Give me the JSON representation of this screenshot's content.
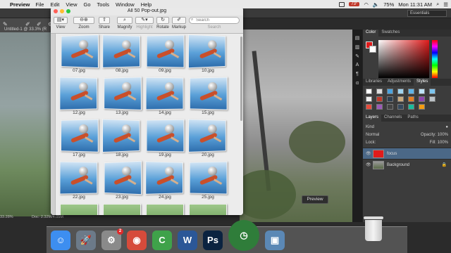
{
  "menubar": {
    "apple": "",
    "app": "Preview",
    "items": [
      "File",
      "Edit",
      "View",
      "Go",
      "Tools",
      "Window",
      "Help"
    ],
    "temp": "73°",
    "battery": "75%",
    "clock": "Mon 11:31 AM"
  },
  "photoshop": {
    "workspace": "Essentials",
    "doc_tab": "Untitled-1 @ 33.3% (R",
    "status_zoom": "33.28%",
    "status_doc": "Doc: 2.32M/4.05M",
    "preview_label": "Preview",
    "panel_tabs_top": [
      "Color",
      "Swatches"
    ],
    "panel_tabs_mid": [
      "Libraries",
      "Adjustments",
      "Styles"
    ],
    "panel_tabs_layers": [
      "Layers",
      "Channels",
      "Paths"
    ],
    "layers_filter": "Kind",
    "blend_mode": "Normal",
    "opacity_label": "Opacity:",
    "opacity_value": "100%",
    "lock_label": "Lock:",
    "fill_label": "Fill:",
    "fill_value": "100%",
    "layers": [
      {
        "name": "focus",
        "selected": true
      },
      {
        "name": "Background",
        "selected": false
      }
    ],
    "colors": {
      "foreground": "#e01b1b",
      "background": "#ffffff"
    }
  },
  "quicklook": {
    "title": "All 50 Pop-out.jpg",
    "toolbar": {
      "view": "View",
      "zoom": "Zoom",
      "share": "Share",
      "magnify": "Magnify",
      "highlight": "Highlight",
      "rotate": "Rotate",
      "markup": "Markup",
      "search_label": "Search",
      "search_placeholder": "Search"
    },
    "thumbnails": [
      "07.jpg",
      "08.jpg",
      "09.jpg",
      "10.jpg",
      "12.jpg",
      "13.jpg",
      "14.jpg",
      "15.jpg",
      "17.jpg",
      "18.jpg",
      "19.jpg",
      "20.jpg",
      "22.jpg",
      "23.jpg",
      "24.jpg",
      "25.jpg"
    ]
  },
  "dock": {
    "items": [
      {
        "name": "finder-icon",
        "glyph": "☺",
        "bg": "#3d8ef0"
      },
      {
        "name": "launchpad-icon",
        "glyph": "🚀",
        "bg": "#6c7a89"
      },
      {
        "name": "system-preferences-icon",
        "glyph": "⚙",
        "bg": "#8a8a8a",
        "badge": "2"
      },
      {
        "name": "chrome-icon",
        "glyph": "◉",
        "bg": "#d64b3b"
      },
      {
        "name": "camtasia-icon",
        "glyph": "C",
        "bg": "#3fa24a"
      },
      {
        "name": "word-icon",
        "glyph": "W",
        "bg": "#2b5797"
      },
      {
        "name": "photoshop-icon",
        "glyph": "Ps",
        "bg": "#0b2340"
      },
      {
        "name": "clock-icon",
        "glyph": "◷",
        "bg": "#2f7d3a"
      },
      {
        "name": "preview-icon",
        "glyph": "▣",
        "bg": "#5b88b5"
      }
    ]
  }
}
